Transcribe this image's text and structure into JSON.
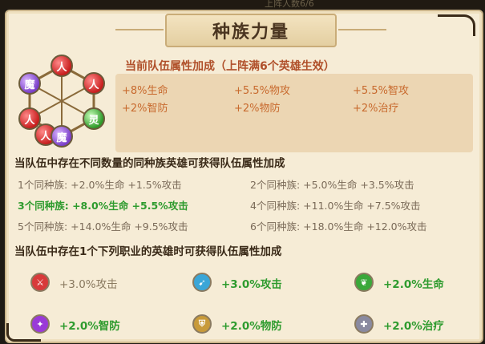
{
  "top_strip_text": "上阵人数6/6",
  "title": "种族力量",
  "emblem": {
    "orbs": [
      {
        "glyph": "人",
        "color": "red"
      },
      {
        "glyph": "人",
        "color": "red"
      },
      {
        "glyph": "人",
        "color": "red"
      },
      {
        "glyph": "人",
        "color": "red"
      },
      {
        "glyph": "灵",
        "color": "green"
      },
      {
        "glyph": "魔",
        "color": "purple"
      },
      {
        "glyph": "魔",
        "color": "purple"
      }
    ]
  },
  "current_bonus": {
    "heading": "当前队伍属性加成（上阵满6个英雄生效）",
    "values": [
      "+8%生命",
      "+5.5%物攻",
      "+5.5%智攻",
      "+2%智防",
      "+2%物防",
      "+2%治疗"
    ]
  },
  "race_section": {
    "title": "当队伍中存在不同数量的同种族英雄可获得队伍属性加成",
    "tiers": [
      {
        "label": "1个同种族:",
        "bonus": "+2.0%生命 +1.5%攻击",
        "active": false
      },
      {
        "label": "2个同种族:",
        "bonus": "+5.0%生命 +3.5%攻击",
        "active": false
      },
      {
        "label": "3个同种族:",
        "bonus": "+8.0%生命 +5.5%攻击",
        "active": true
      },
      {
        "label": "4个同种族:",
        "bonus": "+11.0%生命 +7.5%攻击",
        "active": false
      },
      {
        "label": "5个同种族:",
        "bonus": "+14.0%生命 +9.5%攻击",
        "active": false
      },
      {
        "label": "6个同种族:",
        "bonus": "+18.0%生命 +12.0%攻击",
        "active": false
      }
    ]
  },
  "job_section": {
    "title": "当队伍中存在1个下列职业的英雄时可获得队伍属性加成",
    "jobs": [
      {
        "icon": "sword-icon",
        "color": "#d83a3a",
        "text": "+3.0%攻击",
        "active": false
      },
      {
        "icon": "bow-icon",
        "color": "#3aa6d8",
        "text": "+3.0%攻击",
        "active": true
      },
      {
        "icon": "leaf-icon",
        "color": "#3aa83a",
        "text": "+2.0%生命",
        "active": true
      },
      {
        "icon": "staff-icon",
        "color": "#9a3ad8",
        "text": "+2.0%智防",
        "active": true
      },
      {
        "icon": "shield-icon",
        "color": "#c89a3a",
        "text": "+2.0%物防",
        "active": true
      },
      {
        "icon": "cross-icon",
        "color": "#8a8aa0",
        "text": "+2.0%治疗",
        "active": true
      }
    ]
  }
}
